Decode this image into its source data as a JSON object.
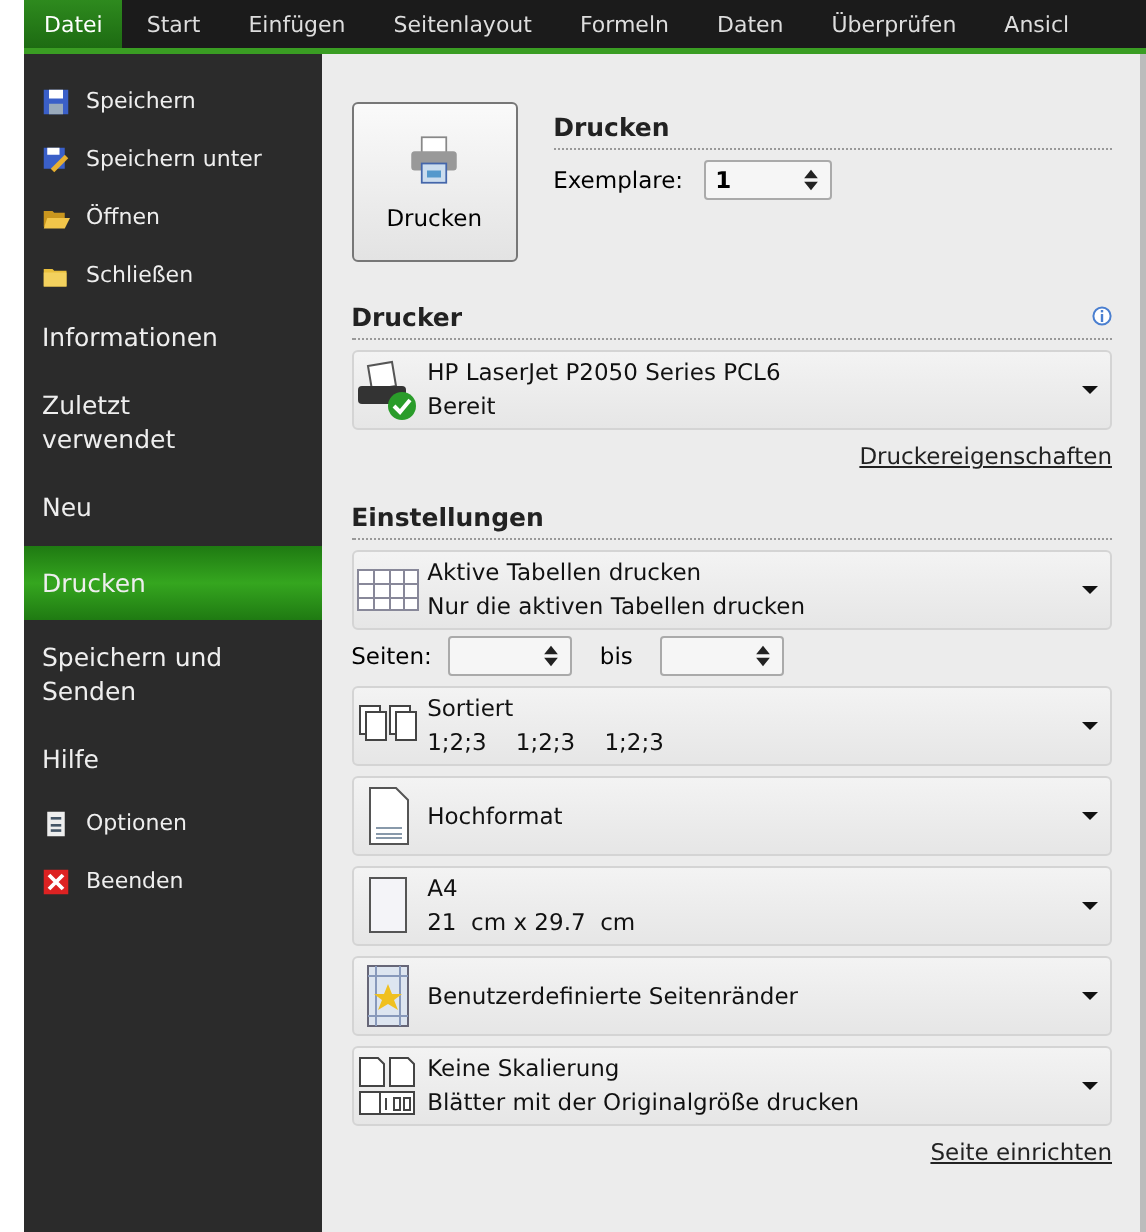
{
  "tabs": [
    {
      "label": "Datei",
      "selected": true
    },
    {
      "label": "Start",
      "selected": false
    },
    {
      "label": "Einfügen",
      "selected": false
    },
    {
      "label": "Seitenlayout",
      "selected": false
    },
    {
      "label": "Formeln",
      "selected": false
    },
    {
      "label": "Daten",
      "selected": false
    },
    {
      "label": "Überprüfen",
      "selected": false
    },
    {
      "label": "Ansicl",
      "selected": false
    }
  ],
  "sidebar": {
    "items": [
      {
        "kind": "command",
        "label": "Speichern",
        "selected": false
      },
      {
        "kind": "command",
        "label": "Speichern unter",
        "selected": false
      },
      {
        "kind": "command",
        "label": "Öffnen",
        "selected": false
      },
      {
        "kind": "command",
        "label": "Schließen",
        "selected": false
      },
      {
        "kind": "page",
        "label": "Informationen",
        "selected": false
      },
      {
        "kind": "page",
        "label": "Zuletzt verwendet",
        "selected": false
      },
      {
        "kind": "page",
        "label": "Neu",
        "selected": false
      },
      {
        "kind": "page",
        "label": "Drucken",
        "selected": true
      },
      {
        "kind": "page",
        "label": "Speichern und Senden",
        "selected": false
      },
      {
        "kind": "page",
        "label": "Hilfe",
        "selected": false
      },
      {
        "kind": "command",
        "label": "Optionen",
        "selected": false
      },
      {
        "kind": "command",
        "label": "Beenden",
        "selected": false
      }
    ]
  },
  "print": {
    "button": "Drucken",
    "heading": "Drucken",
    "copies_label": "Exemplare:",
    "copies": "1"
  },
  "printer": {
    "heading": "Drucker",
    "name": "HP LaserJet P2050 Series PCL6",
    "status": "Bereit",
    "link": "Druckereigenschaften"
  },
  "settings": {
    "heading": "Einstellungen",
    "pages_label": "Seiten:",
    "to_label": "bis",
    "link": "Seite einrichten",
    "options": [
      {
        "title": "Aktive Tabellen drucken",
        "subtitle": "Nur die aktiven Tabellen drucken"
      },
      {
        "title": "Sortiert",
        "subtitle": "1;2;3    1;2;3    1;2;3"
      },
      {
        "title": "Hochformat"
      },
      {
        "title": "A4",
        "subtitle": "21  cm x 29.7  cm"
      },
      {
        "title": "Benutzerdefinierte Seitenränder"
      },
      {
        "title": "Keine Skalierung",
        "subtitle": "Blätter mit der Originalgröße drucken"
      }
    ]
  }
}
